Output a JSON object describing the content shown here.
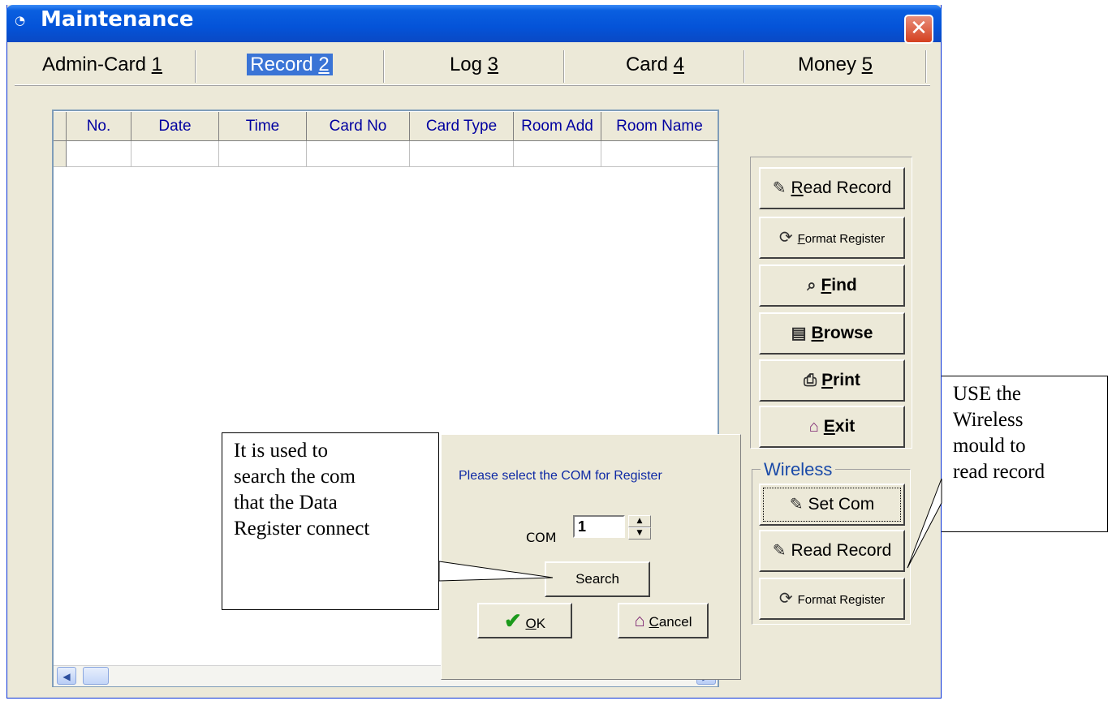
{
  "window": {
    "title": "Maintenance",
    "close_glyph": "✕"
  },
  "tabs": [
    {
      "label": "Admin-Card ",
      "key": "1"
    },
    {
      "label": "Record ",
      "key": "2",
      "active": true
    },
    {
      "label": "Log ",
      "key": "3"
    },
    {
      "label": "Card ",
      "key": "4"
    },
    {
      "label": "Money ",
      "key": "5"
    }
  ],
  "grid": {
    "columns": [
      "No.",
      "Date",
      "Time",
      "Card No",
      "Card Type",
      "Room Add",
      "Room Name"
    ]
  },
  "buttons": {
    "read_record": {
      "key": "R",
      "rest": "ead Record"
    },
    "format_register": {
      "key": "F",
      "rest": "ormat Register"
    },
    "find": {
      "key": "F",
      "rest": "ind"
    },
    "browse": {
      "key": "B",
      "rest": "rowse"
    },
    "print": {
      "key": "P",
      "rest": "rint"
    },
    "exit": {
      "key": "E",
      "rest": "xit"
    }
  },
  "wireless": {
    "legend": "Wireless",
    "set_com": "Set Com",
    "read_record": "Read Record",
    "format_register": "Format Register"
  },
  "com_dialog": {
    "prompt": "Please select the COM for Register",
    "com_label": "COM",
    "com_value": "1",
    "search_label": "Search",
    "ok_key": "O",
    "ok_rest": "K",
    "cancel_key": "C",
    "cancel_rest": "ancel"
  },
  "callouts": {
    "left": [
      "It is used to",
      "search the com",
      "that the Data",
      "Register connect"
    ],
    "right": [
      "USE the",
      "Wireless",
      "mould to",
      "read record"
    ]
  },
  "colors": {
    "title_bar": "#0453d8",
    "window_bg": "#ece9d8",
    "header_text": "#0000a0",
    "wireless_legend": "#1a4aa8"
  }
}
